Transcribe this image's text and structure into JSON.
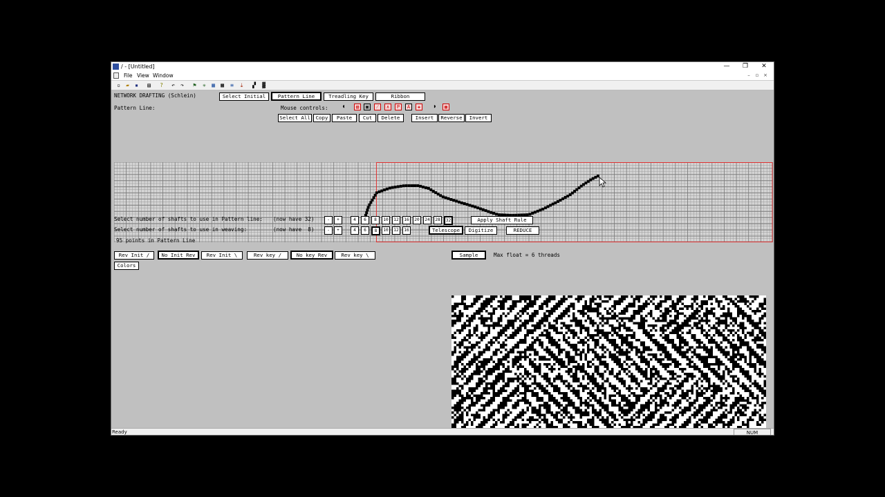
{
  "window": {
    "title": "/ - [Untitled]",
    "controls": {
      "minimize": "—",
      "restore": "❐",
      "close": "✕"
    }
  },
  "menu": {
    "items": [
      "File",
      "View",
      "Window"
    ],
    "mdi": {
      "minimize": "–",
      "restore": "▫",
      "close": "×"
    }
  },
  "toolbar": {
    "icons": [
      "new-icon",
      "open-icon",
      "save-icon",
      "print-icon",
      "help-icon",
      "undo-icon",
      "redo-icon",
      "flag-icon",
      "asterisk-icon",
      "grid-icon",
      "table-icon",
      "lines-icon",
      "arrow-icon",
      "checker-icon",
      "pattern-icon"
    ]
  },
  "header": {
    "title": "NETWORK DRAFTING (Schlein)",
    "tabs": [
      "Select Initial",
      "Pattern Line",
      "Treadling Key",
      "Ribbon"
    ],
    "active_tab": "Pattern Line",
    "pattern_line_label": "Pattern Line:",
    "mouse_controls_label": "Mouse controls:"
  },
  "edit_buttons": [
    "Select All",
    "Copy",
    "Paste",
    "Cut",
    "Delete",
    "Insert",
    "Reverse",
    "Invert"
  ],
  "pattern_grid": {
    "columns": 108,
    "rows": 13,
    "selection_start_col": 43,
    "points": 95
  },
  "shafts_pattern": {
    "label": "Select number of shafts to use in Pattern line:",
    "now_have": "(now have 32)",
    "minus": "-",
    "plus": "+",
    "options": [
      "4",
      "6",
      "8",
      "10",
      "12",
      "16",
      "20",
      "24",
      "28",
      "32"
    ],
    "selected": "32",
    "apply_label": "Apply Shaft Rule"
  },
  "shafts_weaving": {
    "label": "Select number of shafts to use in weaving:",
    "now_have": "(now have  8)",
    "minus": "-",
    "plus": "+",
    "options": [
      "4",
      "6",
      "8",
      "10",
      "12",
      "16"
    ],
    "selected": "8",
    "telescope_label": "Telescope",
    "digitize_label": "Digitize",
    "reduce_label": "REDUCE"
  },
  "points_text": "95 points in Pattern Line",
  "rev_buttons": [
    "Rev Init /",
    "No Init Rev",
    "Rev Init \\",
    "Rev key /",
    "No key Rev",
    "Rev key \\"
  ],
  "colors_label": "Colors",
  "sample": {
    "button_label": "Sample",
    "max_float_text": "Max float = 6 threads"
  },
  "status": {
    "text": "Ready",
    "num": "NUM"
  },
  "colors": {
    "client_bg": "#c0c0c0",
    "selection": "#e03030",
    "grid_line": "#7a7a7a"
  }
}
